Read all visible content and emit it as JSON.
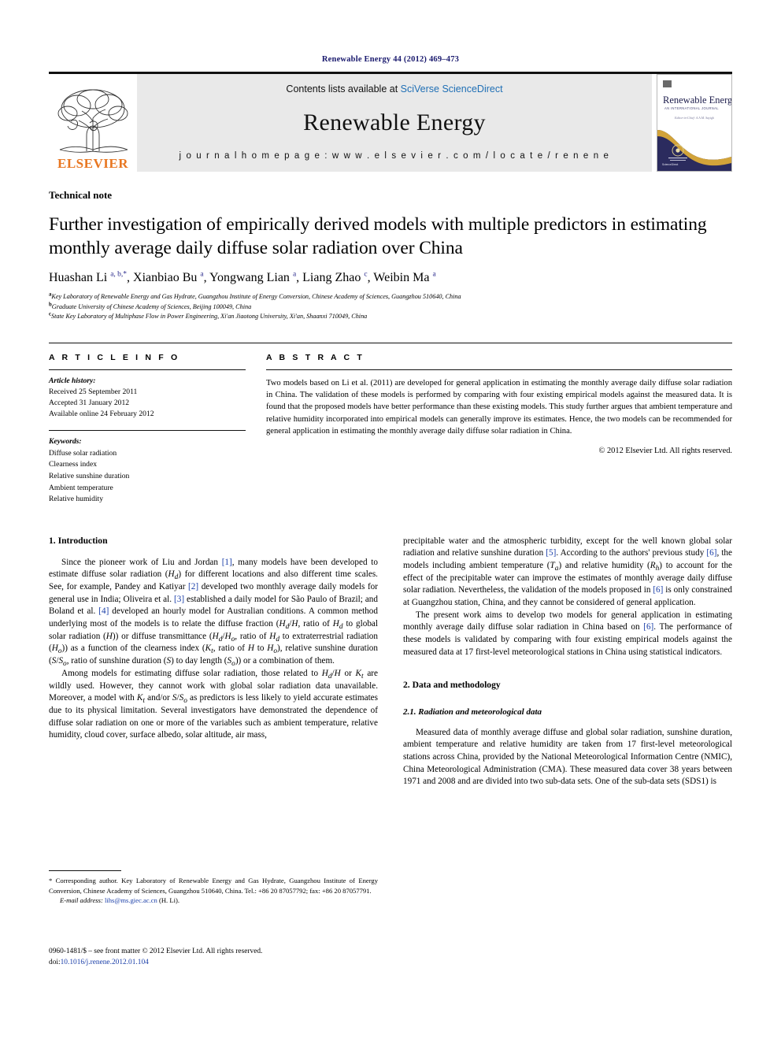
{
  "running_head": "Renewable Energy 44 (2012) 469–473",
  "masthead": {
    "publisher_name": "ELSEVIER",
    "contents_prefix": "Contents lists available at ",
    "contents_link": "SciVerse ScienceDirect",
    "journal_title": "Renewable Energy",
    "homepage": "j o u r n a l   h o m e p a g e :   w w w . e l s e v i e r . c o m / l o c a t e / r e n e n e",
    "cover": {
      "title": "Renewable Energy",
      "subtitle": "AN INTERNATIONAL JOURNAL",
      "editor_line": "Editor-in-Chief: A.A.M. Sayigh",
      "footer_brand": "ScienceDirect"
    }
  },
  "article": {
    "type": "Technical note",
    "title": "Further investigation of empirically derived models with multiple predictors in estimating monthly average daily diffuse solar radiation over China",
    "authors_html": "Huashan Li <sup>a, b,</sup><sup>*</sup>, Xianbiao Bu <sup>a</sup>, Yongwang Lian <sup>a</sup>, Liang Zhao <sup>c</sup>, Weibin Ma <sup>a</sup>",
    "affiliations": [
      {
        "marker": "a",
        "text": "Key Laboratory of Renewable Energy and Gas Hydrate, Guangzhou Institute of Energy Conversion, Chinese Academy of Sciences, Guangzhou 510640, China"
      },
      {
        "marker": "b",
        "text": "Graduate University of Chinese Academy of Sciences, Beijing 100049, China"
      },
      {
        "marker": "c",
        "text": "State Key Laboratory of Multiphase Flow in Power Engineering, Xi'an Jiaotong University, Xi'an, Shaanxi 710049, China"
      }
    ]
  },
  "article_info": {
    "heading": "A R T I C L E   I N F O",
    "history_label": "Article history:",
    "history": [
      "Received 25 September 2011",
      "Accepted 31 January 2012",
      "Available online 24 February 2012"
    ],
    "keywords_label": "Keywords:",
    "keywords": [
      "Diffuse solar radiation",
      "Clearness index",
      "Relative sunshine duration",
      "Ambient temperature",
      "Relative humidity"
    ]
  },
  "abstract": {
    "heading": "A B S T R A C T",
    "text": "Two models based on Li et al. (2011) are developed for general application in estimating the monthly average daily diffuse solar radiation in China. The validation of these models is performed by comparing with four existing empirical models against the measured data. It is found that the proposed models have better performance than these existing models. This study further argues that ambient temperature and relative humidity incorporated into empirical models can generally improve its estimates. Hence, the two models can be recommended for general application in estimating the monthly average daily diffuse solar radiation in China.",
    "copyright": "© 2012 Elsevier Ltd. All rights reserved."
  },
  "sections": {
    "intro_heading": "1.  Introduction",
    "intro_p1_html": "Since the pioneer work of Liu and Jordan <span class=\"ref\">[1]</span>, many models have been developed to estimate diffuse solar radiation (<i>H<sub>d</sub></i>) for different locations and also different time scales. See, for example, Pandey and Katiyar <span class=\"ref\">[2]</span> developed two monthly average daily models for general use in India; Oliveira et al. <span class=\"ref\">[3]</span> established a daily model for São Paulo of Brazil; and Boland et al. <span class=\"ref\">[4]</span> developed an hourly model for Australian conditions. A common method underlying most of the models is to relate the diffuse fraction (<i>H<sub>d</sub></i>/<i>H</i>, ratio of <i>H<sub>d</sub></i> to global solar radiation (<i>H</i>)) or diffuse transmittance (<i>H<sub>d</sub></i>/<i>H<sub>o</sub></i>, ratio of <i>H<sub>d</sub></i> to extraterrestrial radiation (<i>H<sub>o</sub></i>)) as a function of the clearness index (<i>K<sub>t</sub></i>, ratio of <i>H</i> to <i>H<sub>o</sub></i>), relative sunshine duration (<i>S</i>/<i>S<sub>o</sub></i>, ratio of sunshine duration (<i>S</i>) to day length (<i>S<sub>o</sub></i>)) or a combination of them.",
    "intro_p2_html": "Among models for estimating diffuse solar radiation, those related to <i>H<sub>d</sub></i>/<i>H</i> or <i>K<sub>t</sub></i> are wildly used. However, they cannot work with global solar radiation data unavailable. Moreover, a model with <i>K<sub>t</sub></i> and/or <i>S</i>/<i>S<sub>o</sub></i> as predictors is less likely to yield accurate estimates due to its physical limitation. Several investigators have demonstrated the dependence of diffuse solar radiation on one or more of the variables such as ambient temperature, relative humidity, cloud cover, surface albedo, solar altitude, air mass,",
    "right_p1_html": "precipitable water and the atmospheric turbidity, except for the well known global solar radiation and relative sunshine duration <span class=\"ref\">[5]</span>. According to the authors' previous study <span class=\"ref\">[6]</span>, the models including ambient temperature (<i>T<sub>a</sub></i>) and relative humidity (<i>R<sub>h</sub></i>) to account for the effect of the precipitable water can improve the estimates of monthly average daily diffuse solar radiation. Nevertheless, the validation of the models proposed in <span class=\"ref\">[6]</span> is only constrained at Guangzhou station, China, and they cannot be considered of general application.",
    "right_p2_html": "The present work aims to develop two models for general application in estimating monthly average daily diffuse solar radiation in China based on <span class=\"ref\">[6]</span>. The performance of these models is validated by comparing with four existing empirical models against the measured data at 17 first-level meteorological stations in China using statistical indicators.",
    "data_heading": "2.  Data and methodology",
    "data_sub_heading": "2.1.  Radiation and meteorological data",
    "data_p1_html": "Measured data of monthly average diffuse and global solar radiation, sunshine duration, ambient temperature and relative humidity are taken from 17 first-level meteorological stations across China, provided by the National Meteorological Information Centre (NMIC), China Meteorological Administration (CMA). These measured data cover 38 years between 1971 and 2008 and are divided into two sub-data sets. One of the sub-data sets (SDS1) is"
  },
  "footnote": {
    "corresponding_html": "* Corresponding author. Key Laboratory of Renewable Energy and Gas Hydrate, Guangzhou Institute of Energy Conversion, Chinese Academy of Sciences, Guangzhou 510640, China. Tel.: +86 20 87057792; fax: +86 20 87057791.",
    "email_html": "<span class=\"em\">E-mail address:</span> <span class=\"lnk\">lihs@ms.giec.ac.cn</span> (H. Li)."
  },
  "colophon": {
    "issn_line": "0960-1481/$ – see front matter © 2012 Elsevier Ltd. All rights reserved.",
    "doi_prefix": "doi:",
    "doi": "10.1016/j.renene.2012.01.104"
  },
  "colors": {
    "link": "#1F6FB5",
    "reference": "#1a3ea8",
    "running_head": "#1a1a6e",
    "elsevier_orange": "#E87722",
    "band_gray": "#e9e9e9",
    "cover_navy": "#2b2b5e"
  }
}
